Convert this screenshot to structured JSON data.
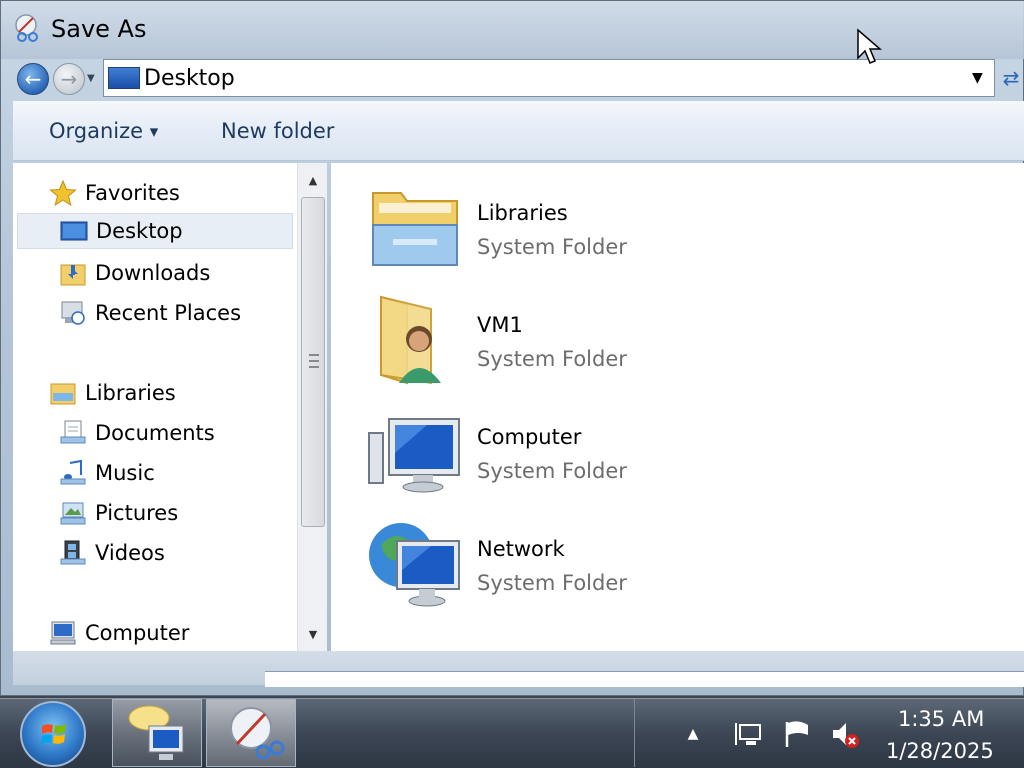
{
  "window": {
    "title": "Save As"
  },
  "address_bar": {
    "location": "Desktop"
  },
  "toolbar": {
    "organize_label": "Organize",
    "new_folder_label": "New folder"
  },
  "nav_pane": {
    "groups": [
      {
        "label": "Favorites",
        "icon": "star-icon"
      },
      {
        "label": "Desktop",
        "icon": "desktop-icon",
        "selected": true
      },
      {
        "label": "Downloads",
        "icon": "downloads-icon"
      },
      {
        "label": "Recent Places",
        "icon": "recent-places-icon"
      },
      {
        "label": "Libraries",
        "icon": "libraries-icon"
      },
      {
        "label": "Documents",
        "icon": "documents-icon"
      },
      {
        "label": "Music",
        "icon": "music-icon"
      },
      {
        "label": "Pictures",
        "icon": "pictures-icon"
      },
      {
        "label": "Videos",
        "icon": "videos-icon"
      },
      {
        "label": "Computer",
        "icon": "computer-icon"
      }
    ]
  },
  "content": {
    "items": [
      {
        "name": "Libraries",
        "type": "System Folder",
        "icon": "libraries-folder-icon"
      },
      {
        "name": "VM1",
        "type": "System Folder",
        "icon": "user-folder-icon"
      },
      {
        "name": "Computer",
        "type": "System Folder",
        "icon": "computer-icon"
      },
      {
        "name": "Network",
        "type": "System Folder",
        "icon": "network-icon"
      }
    ]
  },
  "taskbar": {
    "clock_time": "1:35 AM",
    "clock_date": "1/28/2025",
    "colors": {
      "accent": "#2f79c8"
    }
  }
}
